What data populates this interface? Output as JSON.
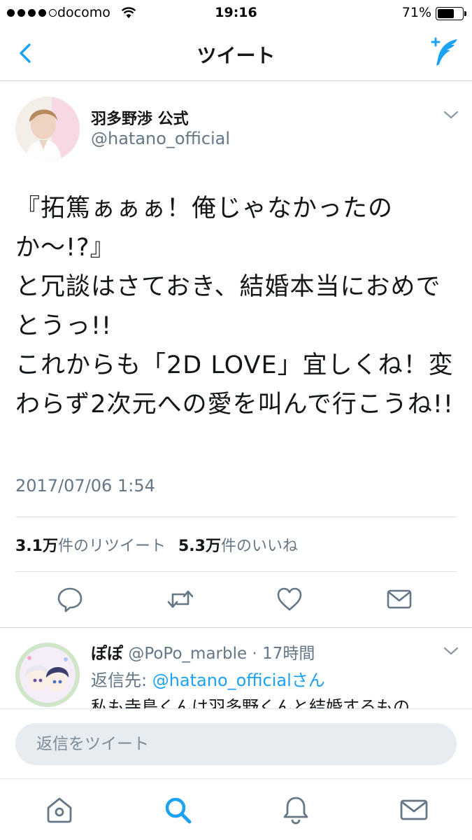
{
  "status_bar": {
    "carrier": "docomo",
    "time": "19:16",
    "battery_percent_label": "71%",
    "battery_level": 0.71
  },
  "nav": {
    "title": "ツイート"
  },
  "tweet": {
    "author_name": "羽多野渉 公式",
    "author_handle": "@hatano_official",
    "text": "『拓篤ぁぁぁ！俺じゃなかったのか〜!?』\nと冗談はさておき、結婚本当におめでとうっ!!\nこれからも「2D LOVE」宜しくね！変わらず2次元への愛を叫んで行こうね!!",
    "timestamp": "2017/07/06 1:54",
    "retweet_count": "3.1万",
    "retweet_label": "件のリツイート",
    "like_count": "5.3万",
    "like_label": "件のいいね"
  },
  "reply": {
    "name": "ぽぽ",
    "handle": "@PoPo_marble",
    "time": "· 17時間",
    "reply_to_prefix": "返信先: ",
    "reply_to_mention": "@hatano_officialさん",
    "text": "私も寺島くんは羽多野くんと結婚するもの"
  },
  "composer": {
    "placeholder": "返信をツイート"
  },
  "icons": {
    "back": "chevron-left-icon",
    "compose": "compose-tweet-icon",
    "reply": "reply-icon",
    "retweet": "retweet-icon",
    "like": "heart-icon",
    "dm": "envelope-icon",
    "home": "home-icon",
    "search": "search-icon",
    "notifications": "bell-icon",
    "messages": "envelope-icon"
  },
  "colors": {
    "accent": "#1da1f2",
    "secondary_text": "#657786",
    "icon_gray": "#657786"
  }
}
